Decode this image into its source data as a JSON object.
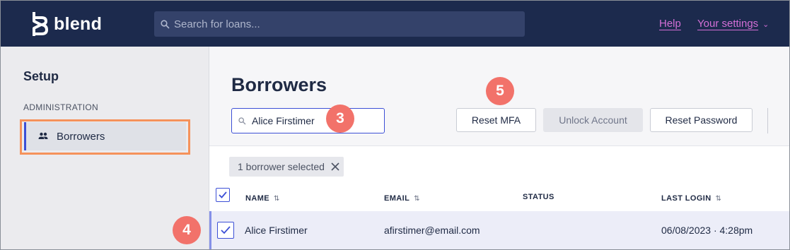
{
  "header": {
    "brand": "blend",
    "search_placeholder": "Search for loans...",
    "help_label": "Help",
    "settings_label": "Your settings"
  },
  "sidebar": {
    "title": "Setup",
    "section_label": "ADMINISTRATION",
    "items": [
      {
        "label": "Borrowers",
        "icon": "people-icon",
        "active": true
      }
    ]
  },
  "main": {
    "title": "Borrowers",
    "filter_value": "Alice Firstimer",
    "buttons": {
      "reset_mfa": "Reset MFA",
      "unlock_account": "Unlock Account",
      "reset_password": "Reset Password"
    },
    "selection_chip": "1 borrower selected",
    "table": {
      "columns": [
        "NAME",
        "EMAIL",
        "STATUS",
        "LAST LOGIN"
      ],
      "rows": [
        {
          "name": "Alice Firstimer",
          "email": "afirstimer@email.com",
          "status": "",
          "last_login": "06/08/2023 · 4:28pm",
          "selected": true
        }
      ]
    }
  },
  "annotations": {
    "badge_3": "3",
    "badge_4": "4",
    "badge_5": "5"
  },
  "colors": {
    "header_bg": "#1c2a4d",
    "accent": "#3c4fd6",
    "link": "#d36fd6",
    "callout": "#f2726a",
    "highlight_box": "#f5925b"
  }
}
